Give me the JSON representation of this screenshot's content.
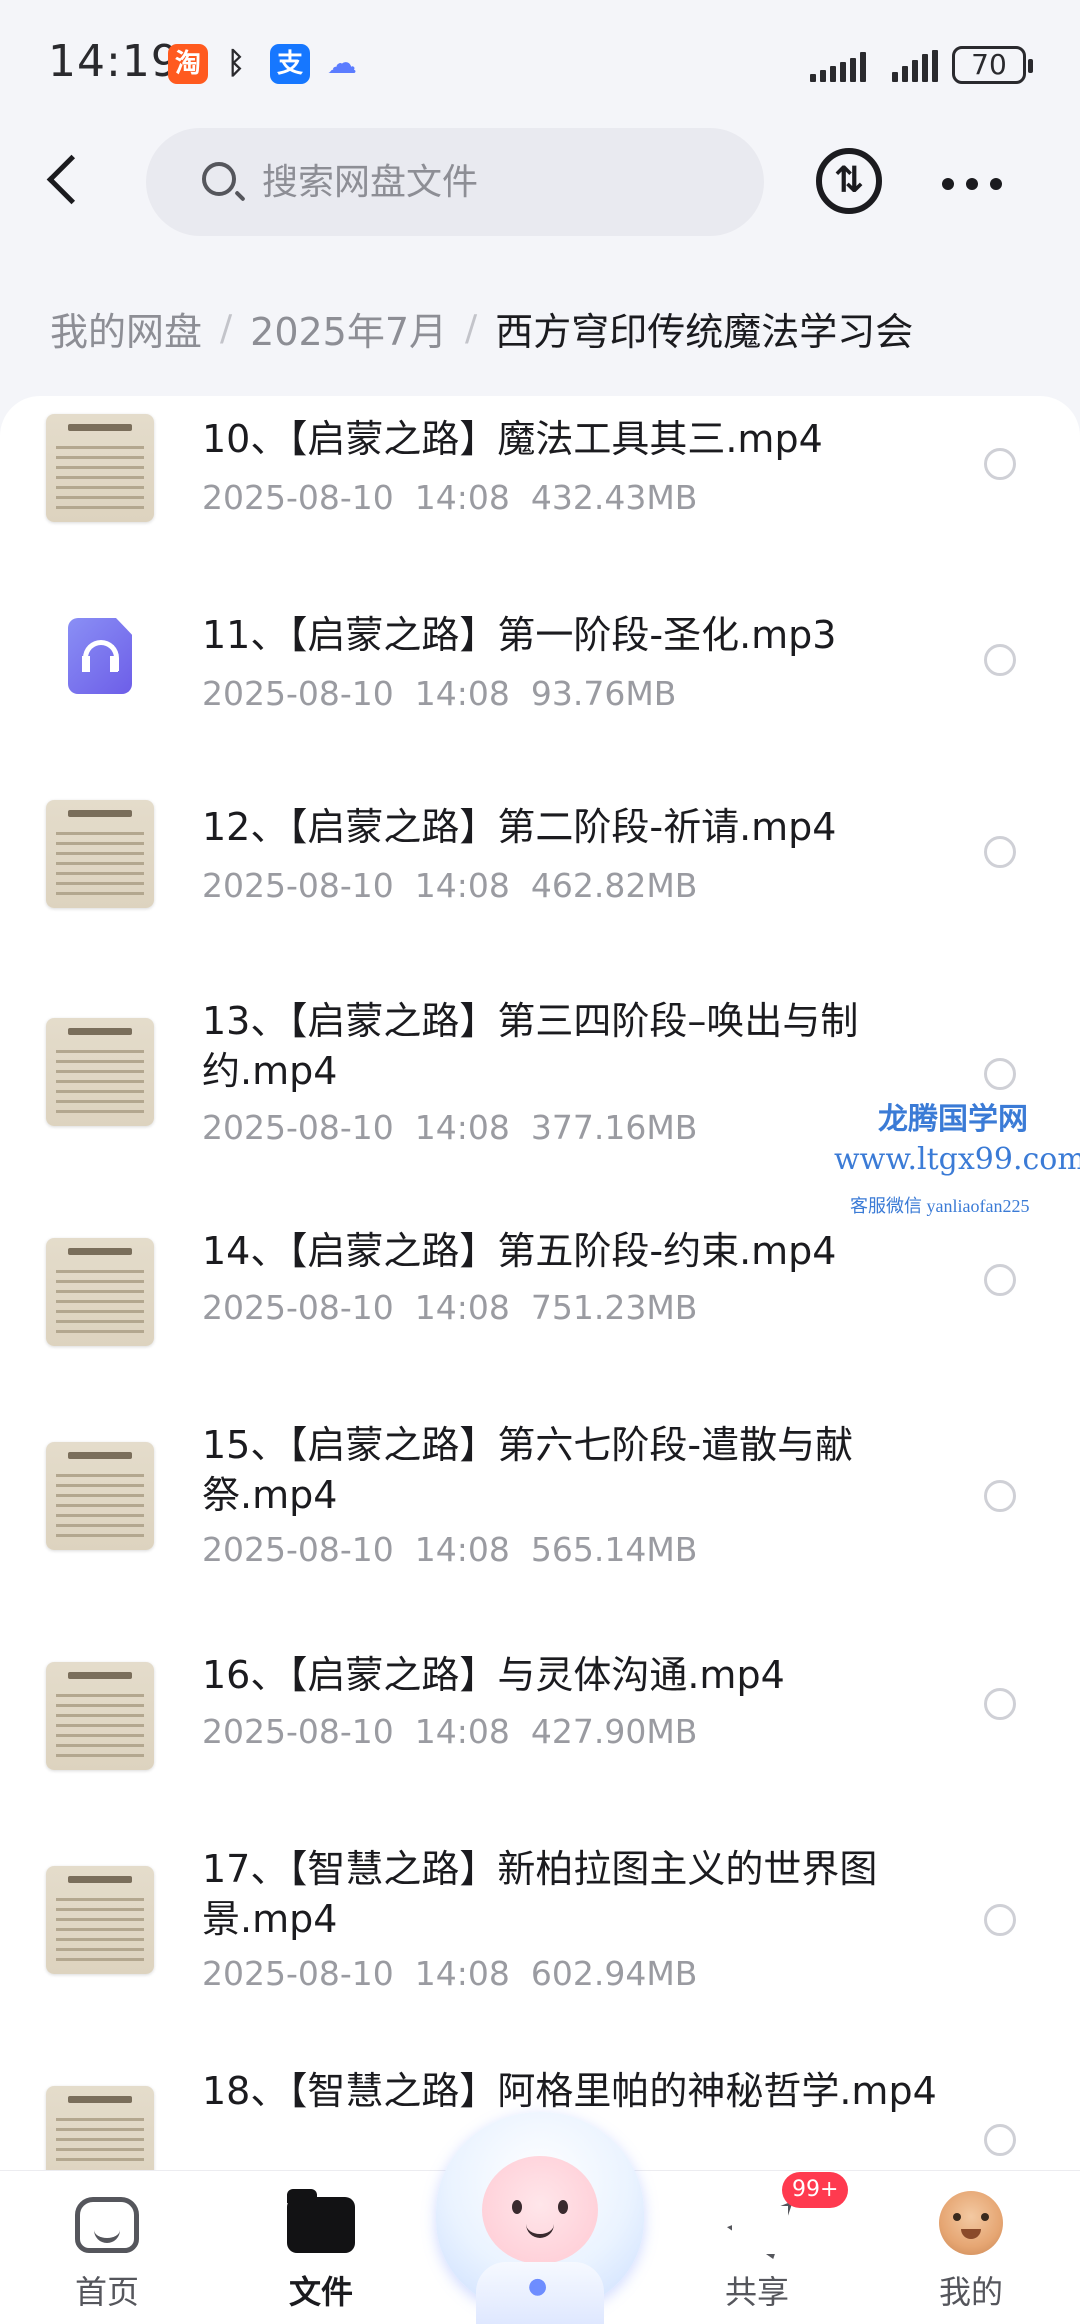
{
  "status_bar": {
    "time": "14:19",
    "battery": "70",
    "app_icons": [
      "taobao-icon",
      "bluetooth-icon",
      "alipay-icon",
      "baidu-netdisk-icon"
    ],
    "taobao_glyph": "淘",
    "alipay_glyph": "支"
  },
  "header": {
    "search_placeholder": "搜索网盘文件"
  },
  "breadcrumb": {
    "items": [
      "我的网盘",
      "2025年7月",
      "西方穹印传统魔法学习会"
    ]
  },
  "files": [
    {
      "name": "10、【启蒙之路】魔法工具其三.mp4",
      "date": "2025-08-10  14:08",
      "size": "432.43MB",
      "type": "video"
    },
    {
      "name": "11、【启蒙之路】第一阶段-圣化.mp3",
      "date": "2025-08-10  14:08",
      "size": "93.76MB",
      "type": "audio"
    },
    {
      "name": "12、【启蒙之路】第二阶段-祈请.mp4",
      "date": "2025-08-10  14:08",
      "size": "462.82MB",
      "type": "video"
    },
    {
      "name": "13、【启蒙之路】第三四阶段–唤出与制约.mp4",
      "date": "2025-08-10  14:08",
      "size": "377.16MB",
      "type": "video"
    },
    {
      "name": "14、【启蒙之路】第五阶段-约束.mp4",
      "date": "2025-08-10  14:08",
      "size": "751.23MB",
      "type": "video"
    },
    {
      "name": "15、【启蒙之路】第六七阶段-遣散与献祭.mp4",
      "date": "2025-08-10  14:08",
      "size": "565.14MB",
      "type": "video"
    },
    {
      "name": "16、【启蒙之路】与灵体沟通.mp4",
      "date": "2025-08-10  14:08",
      "size": "427.90MB",
      "type": "video"
    },
    {
      "name": "17、【智慧之路】新柏拉图主义的世界图景.mp4",
      "date": "2025-08-10  14:08",
      "size": "602.94MB",
      "type": "video"
    },
    {
      "name": "18、【智慧之路】阿格里帕的神秘哲学.mp4",
      "date": "",
      "size": "",
      "type": "video"
    }
  ],
  "watermark": {
    "line1": "龙腾国学网",
    "line2": "www.ltgx99.com",
    "line3": "客服微信 yanliaofan225"
  },
  "bottom_nav": {
    "items": [
      {
        "label": "首页",
        "icon": "home-icon"
      },
      {
        "label": "文件",
        "icon": "folder-icon",
        "active": true
      },
      {
        "label": "共享",
        "icon": "paper-plane-icon",
        "badge": "99+"
      },
      {
        "label": "我的",
        "icon": "avatar-icon"
      }
    ]
  },
  "colors": {
    "accent": "#6d5ee8",
    "badge": "#ff3a4f",
    "watermark": "#3b7bd6"
  }
}
